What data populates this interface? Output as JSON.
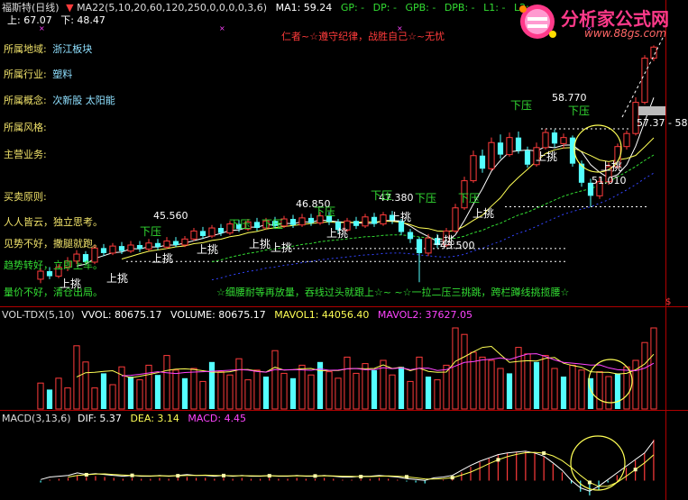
{
  "header": {
    "stock_title": "福斯特(日线)",
    "ma_params": "MA22(5,10,20,60,120,250,0,0,0,0,3,6)",
    "ma1": "MA1: 59.24",
    "gp": "GP: -",
    "dp": "DP: -",
    "gpb": "GPB: -",
    "dpb": "DPB: -",
    "l1": "L1: -",
    "l2": "L2: -",
    "up_price": "上: 67.07",
    "down_price": "下: 48.47",
    "motto": "仁者~☆遵守纪律，战胜自己☆~无忧"
  },
  "logo": {
    "brand": "分析家公式网",
    "url": "www.88gs.com"
  },
  "side_info": {
    "region_label": "所属地域:",
    "region_value": "浙江板块",
    "industry_label": "所属行业:",
    "industry_value": "塑料",
    "concept_label": "所属概念:",
    "concept_value": "次新股 太阳能",
    "style_label": "所属风格:",
    "style_value": "",
    "business_label": "主营业务:",
    "business_value": "",
    "principle_label": "买卖原则:",
    "principle_1": "人人皆云，独立思考。",
    "principle_2": "见势不好，撒腿就跑。",
    "principle_3": "趋势转好，立即上车。",
    "principle_4": "量价不好，清仓出局。"
  },
  "chart_annotations": {
    "scroll_text": "☆细腰耐等再放量，吞线过头就跟上☆~ ~☆一拉二压三挑跳，跨栏蹲线挑揽腰☆",
    "price_labels": [
      "58.770",
      "57.37 - 58",
      "51.010",
      "47.380",
      "46.850",
      "45.560",
      "43.500"
    ],
    "push_label": "下压",
    "pick_label": "上挑",
    "dollar": "$"
  },
  "volume_panel": {
    "title": "VOL-TDX(5,10)",
    "vvol": "VVOL: 80675.17",
    "volume": "VOLUME: 80675.17",
    "mavol1": "MAVOL1: 44056.40",
    "mavol2": "MAVOL2: 37627.05"
  },
  "macd_panel": {
    "title": "MACD(3,13,6)",
    "dif": "DIF: 5.37",
    "dea": "DEA: 3.14",
    "macd": "MACD: 4.45"
  },
  "colors": {
    "up": "#ff3b3b",
    "down": "#54ffff",
    "yellow": "#ffff55",
    "magenta": "#ff44ff",
    "green": "#33dd33",
    "white": "#ffffff",
    "blue": "#3344ff",
    "orange": "#ff8800",
    "axis_red": "#b00000"
  },
  "chart_data": [
    {
      "type": "candlestick",
      "candles": [
        {
          "o": 43.8,
          "c": 44.6,
          "h": 44.9,
          "l": 43.4
        },
        {
          "o": 44.6,
          "c": 44.1,
          "h": 45.0,
          "l": 43.8
        },
        {
          "o": 44.1,
          "c": 45.0,
          "h": 45.3,
          "l": 43.9
        },
        {
          "o": 45.0,
          "c": 45.6,
          "h": 46.0,
          "l": 44.6
        },
        {
          "o": 45.6,
          "c": 46.3,
          "h": 46.7,
          "l": 45.3
        },
        {
          "o": 46.3,
          "c": 45.5,
          "h": 46.6,
          "l": 45.2
        },
        {
          "o": 45.5,
          "c": 46.9,
          "h": 47.2,
          "l": 45.3
        },
        {
          "o": 46.9,
          "c": 46.4,
          "h": 47.3,
          "l": 46.1
        },
        {
          "o": 46.4,
          "c": 47.1,
          "h": 47.4,
          "l": 46.2
        },
        {
          "o": 47.1,
          "c": 46.6,
          "h": 47.5,
          "l": 46.3
        },
        {
          "o": 46.6,
          "c": 47.2,
          "h": 47.6,
          "l": 46.4
        },
        {
          "o": 47.2,
          "c": 46.8,
          "h": 47.6,
          "l": 46.5
        },
        {
          "o": 46.8,
          "c": 47.4,
          "h": 47.8,
          "l": 46.6
        },
        {
          "o": 47.4,
          "c": 47.0,
          "h": 47.8,
          "l": 46.7
        },
        {
          "o": 47.0,
          "c": 47.6,
          "h": 48.0,
          "l": 46.8
        },
        {
          "o": 47.6,
          "c": 47.2,
          "h": 48.0,
          "l": 47.0
        },
        {
          "o": 47.2,
          "c": 47.8,
          "h": 48.1,
          "l": 47.0
        },
        {
          "o": 47.8,
          "c": 48.6,
          "h": 48.9,
          "l": 47.6
        },
        {
          "o": 48.6,
          "c": 48.1,
          "h": 49.0,
          "l": 47.8
        },
        {
          "o": 48.1,
          "c": 48.9,
          "h": 49.2,
          "l": 47.9
        },
        {
          "o": 48.9,
          "c": 48.4,
          "h": 49.3,
          "l": 48.1
        },
        {
          "o": 48.4,
          "c": 49.3,
          "h": 49.6,
          "l": 48.2
        },
        {
          "o": 49.3,
          "c": 48.8,
          "h": 49.7,
          "l": 48.5
        },
        {
          "o": 48.8,
          "c": 49.5,
          "h": 49.8,
          "l": 48.6
        },
        {
          "o": 49.5,
          "c": 48.9,
          "h": 49.9,
          "l": 48.6
        },
        {
          "o": 48.9,
          "c": 49.6,
          "h": 49.9,
          "l": 48.7
        },
        {
          "o": 49.6,
          "c": 49.1,
          "h": 50.0,
          "l": 48.8
        },
        {
          "o": 49.1,
          "c": 49.8,
          "h": 50.1,
          "l": 48.9
        },
        {
          "o": 49.8,
          "c": 49.2,
          "h": 50.2,
          "l": 48.9
        },
        {
          "o": 49.2,
          "c": 49.9,
          "h": 50.3,
          "l": 49.0
        },
        {
          "o": 49.9,
          "c": 49.4,
          "h": 50.3,
          "l": 49.1
        },
        {
          "o": 49.4,
          "c": 50.1,
          "h": 50.5,
          "l": 49.2
        },
        {
          "o": 50.1,
          "c": 49.5,
          "h": 50.5,
          "l": 49.2
        },
        {
          "o": 49.5,
          "c": 48.7,
          "h": 49.8,
          "l": 48.4
        },
        {
          "o": 48.7,
          "c": 49.6,
          "h": 49.9,
          "l": 48.5
        },
        {
          "o": 49.6,
          "c": 49.1,
          "h": 50.0,
          "l": 48.8
        },
        {
          "o": 49.1,
          "c": 50.0,
          "h": 50.3,
          "l": 48.9
        },
        {
          "o": 50.0,
          "c": 49.3,
          "h": 50.4,
          "l": 49.0
        },
        {
          "o": 49.3,
          "c": 50.2,
          "h": 50.5,
          "l": 49.1
        },
        {
          "o": 50.2,
          "c": 49.6,
          "h": 50.6,
          "l": 49.3
        },
        {
          "o": 49.6,
          "c": 48.5,
          "h": 49.8,
          "l": 48.2
        },
        {
          "o": 48.5,
          "c": 47.8,
          "h": 48.8,
          "l": 47.4
        },
        {
          "o": 47.8,
          "c": 46.4,
          "h": 48.0,
          "l": 43.5
        },
        {
          "o": 46.4,
          "c": 47.9,
          "h": 48.3,
          "l": 46.1
        },
        {
          "o": 47.9,
          "c": 47.2,
          "h": 48.3,
          "l": 46.9
        },
        {
          "o": 47.2,
          "c": 48.6,
          "h": 48.9,
          "l": 47.0
        },
        {
          "o": 48.6,
          "c": 50.9,
          "h": 51.3,
          "l": 48.4
        },
        {
          "o": 50.9,
          "c": 53.6,
          "h": 54.0,
          "l": 50.7
        },
        {
          "o": 53.6,
          "c": 56.1,
          "h": 56.6,
          "l": 53.4
        },
        {
          "o": 56.1,
          "c": 54.8,
          "h": 56.7,
          "l": 54.4
        },
        {
          "o": 54.8,
          "c": 57.4,
          "h": 57.9,
          "l": 54.6
        },
        {
          "o": 57.4,
          "c": 56.2,
          "h": 58.2,
          "l": 55.8
        },
        {
          "o": 56.2,
          "c": 57.9,
          "h": 58.4,
          "l": 56.0
        },
        {
          "o": 57.9,
          "c": 56.6,
          "h": 58.5,
          "l": 56.3
        },
        {
          "o": 56.6,
          "c": 55.2,
          "h": 57.0,
          "l": 54.9
        },
        {
          "o": 55.2,
          "c": 56.9,
          "h": 57.4,
          "l": 55.0
        },
        {
          "o": 56.9,
          "c": 58.4,
          "h": 58.77,
          "l": 56.7
        },
        {
          "o": 58.4,
          "c": 57.3,
          "h": 58.7,
          "l": 56.9
        },
        {
          "o": 57.3,
          "c": 57.9,
          "h": 58.3,
          "l": 56.8
        },
        {
          "o": 57.9,
          "c": 55.3,
          "h": 58.1,
          "l": 55.0
        },
        {
          "o": 55.3,
          "c": 53.4,
          "h": 55.6,
          "l": 53.0
        },
        {
          "o": 53.4,
          "c": 52.1,
          "h": 53.8,
          "l": 51.01
        },
        {
          "o": 52.1,
          "c": 53.5,
          "h": 53.9,
          "l": 51.8
        },
        {
          "o": 53.5,
          "c": 55.0,
          "h": 55.4,
          "l": 53.2
        },
        {
          "o": 55.0,
          "c": 57.0,
          "h": 57.3,
          "l": 54.8
        },
        {
          "o": 57.0,
          "c": 58.3,
          "h": 58.6,
          "l": 56.7
        },
        {
          "o": 58.3,
          "c": 61.4,
          "h": 61.9,
          "l": 58.1
        },
        {
          "o": 61.4,
          "c": 65.8,
          "h": 66.1,
          "l": 61.2
        },
        {
          "o": 65.8,
          "c": 66.9,
          "h": 67.07,
          "l": 65.5
        }
      ],
      "price_range": [
        42,
        68
      ]
    },
    {
      "type": "bar",
      "title": "VOL-TDX(5,10)",
      "values": [
        32,
        24,
        38,
        26,
        78,
        58,
        26,
        44,
        30,
        52,
        40,
        36,
        54,
        42,
        66,
        48,
        38,
        50,
        34,
        58,
        46,
        42,
        62,
        36,
        48,
        40,
        72,
        44,
        38,
        54,
        42,
        58,
        46,
        38,
        64,
        44,
        56,
        48,
        60,
        42,
        52,
        34,
        64,
        40,
        36,
        54,
        100,
        92,
        70,
        64,
        60,
        50,
        44,
        76,
        68,
        58,
        66,
        50,
        40,
        54,
        48,
        38,
        46,
        40,
        44,
        52,
        60,
        82,
        100
      ],
      "ylim": [
        0,
        110
      ]
    },
    {
      "type": "bar",
      "title": "MACD(3,13,6)",
      "values": [
        -0.2,
        0.1,
        0.2,
        0.3,
        0.6,
        0.4,
        0.5,
        0.4,
        0.3,
        0.2,
        0.3,
        0.2,
        0.2,
        0.3,
        0.2,
        0.3,
        0.4,
        0.3,
        0.3,
        0.2,
        0.3,
        0.2,
        0.3,
        0.2,
        0.2,
        0.3,
        0.2,
        0.2,
        0.3,
        0.2,
        0.2,
        0.3,
        0.2,
        0.1,
        0.1,
        0.2,
        0.2,
        0.3,
        0.2,
        0.1,
        -0.1,
        -0.2,
        -0.3,
        0.0,
        0.1,
        0.3,
        0.9,
        1.5,
        2.0,
        2.4,
        2.8,
        3.0,
        3.1,
        3.2,
        3.0,
        2.6,
        1.8,
        0.9,
        -0.3,
        -1.2,
        -1.6,
        -1.0,
        -0.2,
        0.6,
        1.4,
        2.2,
        3.0,
        4.45
      ],
      "ylim": [
        -2,
        6
      ]
    }
  ]
}
